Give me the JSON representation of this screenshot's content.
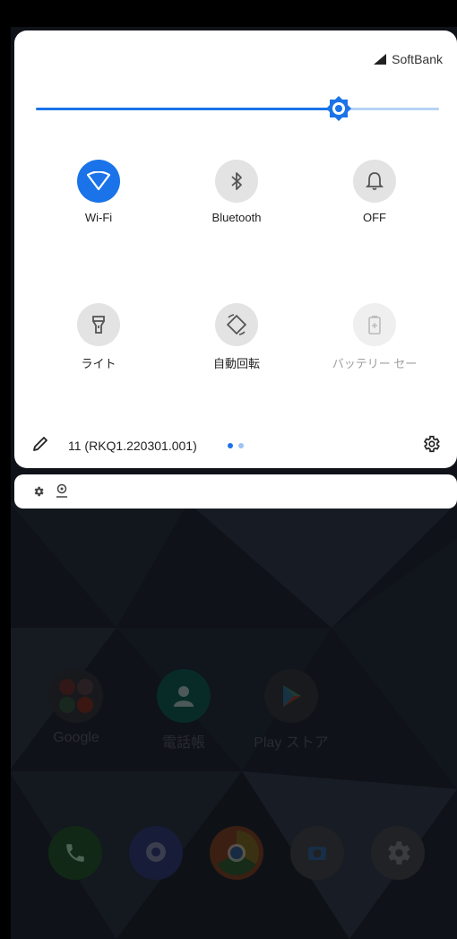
{
  "status": {
    "carrier": "SoftBank"
  },
  "brightness": {
    "level": 0.75
  },
  "tiles": [
    {
      "label": "Wi-Fi",
      "icon": "wifi-icon",
      "state": "on"
    },
    {
      "label": "Bluetooth",
      "icon": "bluetooth-icon",
      "state": "off"
    },
    {
      "label": "OFF",
      "icon": "bell-icon",
      "state": "off"
    },
    {
      "label": "ライト",
      "icon": "flashlight-icon",
      "state": "off"
    },
    {
      "label": "自動回転",
      "icon": "auto-rotate-icon",
      "state": "off"
    },
    {
      "label": "バッテリー セー",
      "icon": "battery-saver-icon",
      "state": "disabled"
    }
  ],
  "footer": {
    "build": "11 (RKQ1.220301.001)",
    "page_count": 2,
    "current_page": 1
  },
  "home": {
    "apps": [
      {
        "label": "Google",
        "icon": "google-folder-icon"
      },
      {
        "label": "電話帳",
        "icon": "contacts-icon"
      },
      {
        "label": "Play ストア",
        "icon": "play-store-icon"
      }
    ],
    "dock": [
      {
        "icon": "phone-icon"
      },
      {
        "icon": "softbank-messenger-icon"
      },
      {
        "icon": "chrome-icon"
      },
      {
        "icon": "camera-icon"
      },
      {
        "icon": "settings-app-icon"
      }
    ]
  },
  "colors": {
    "accent": "#1a73e8",
    "panel": "#ffffff",
    "tile_inactive": "#e3e3e3"
  }
}
